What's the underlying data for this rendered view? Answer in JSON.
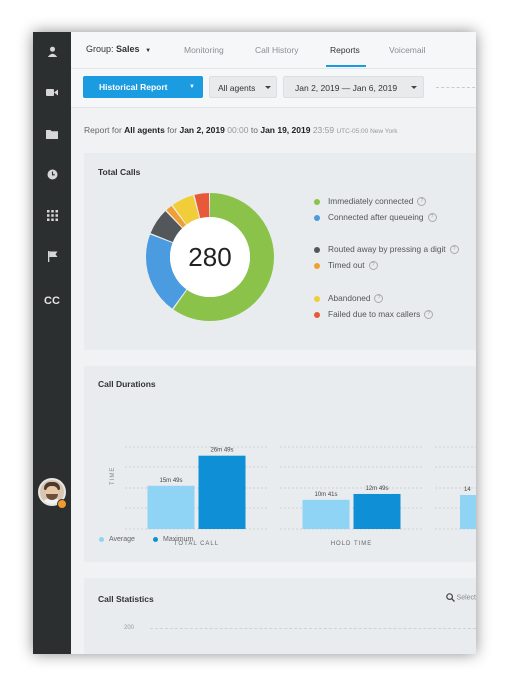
{
  "nav": {
    "group_label": "Group:",
    "group_value": "Sales",
    "tabs": [
      {
        "label": "Monitoring"
      },
      {
        "label": "Call History"
      },
      {
        "label": "Reports"
      },
      {
        "label": "Voicemail"
      }
    ],
    "active_tab": "Reports"
  },
  "sidebar": {
    "icons": [
      "user-icon",
      "video-icon",
      "folder-icon",
      "clock-icon",
      "keypad-icon",
      "flag-icon"
    ],
    "cc_label": "CC"
  },
  "filters": {
    "report_button": "Historical Report",
    "agents_select": "All agents",
    "date_select": "Jan 2, 2019 — Jan 6, 2019"
  },
  "report_for": {
    "prefix": "Report for",
    "agents": "All agents",
    "for_word": "for",
    "start_date": "Jan 2, 2019",
    "start_time": "00:00",
    "to_word": "to",
    "end_date": "Jan 19, 2019",
    "end_time": "23:59",
    "timezone": "UTC-05:00 New York"
  },
  "total_calls": {
    "title": "Total Calls",
    "total": "280",
    "legend": [
      {
        "label": "Immediately connected",
        "color": "#8bc34a"
      },
      {
        "label": "Connected after queueing",
        "color": "#4a9be0"
      },
      {
        "label": "Routed away by pressing a digit",
        "color": "#545759"
      },
      {
        "label": "Timed out",
        "color": "#f0a030"
      },
      {
        "label": "Abandoned",
        "color": "#f2cd3a"
      },
      {
        "label": "Failed due to max callers",
        "color": "#e8593a"
      }
    ],
    "segments_fraction": [
      0.6,
      0.21,
      0.07,
      0.02,
      0.06,
      0.04
    ]
  },
  "call_durations": {
    "title": "Call Durations",
    "y_axis_label": "TIME",
    "legend": [
      {
        "label": "Average",
        "color": "#8fd3f5"
      },
      {
        "label": "Maximum",
        "color": "#0e8fd6"
      }
    ]
  },
  "chart_data": {
    "type": "bar",
    "categories": [
      "TOTAL CALL",
      "HOLD TIME",
      ""
    ],
    "series": [
      {
        "name": "Average",
        "values": [
          949,
          641,
          null
        ],
        "labels": [
          "15m 49s",
          "10m 41s",
          ""
        ]
      },
      {
        "name": "Maximum",
        "values": [
          1609,
          769,
          null
        ],
        "labels": [
          "26m 49s",
          "12m 49s",
          ""
        ]
      }
    ],
    "partial_third_label": "14",
    "ylabel": "TIME",
    "ylim": [
      0,
      1800
    ],
    "grid": true,
    "legend_position": "bottom-left"
  },
  "call_statistics": {
    "title": "Call Statistics",
    "select_label": "Select",
    "y_tick": "200"
  }
}
